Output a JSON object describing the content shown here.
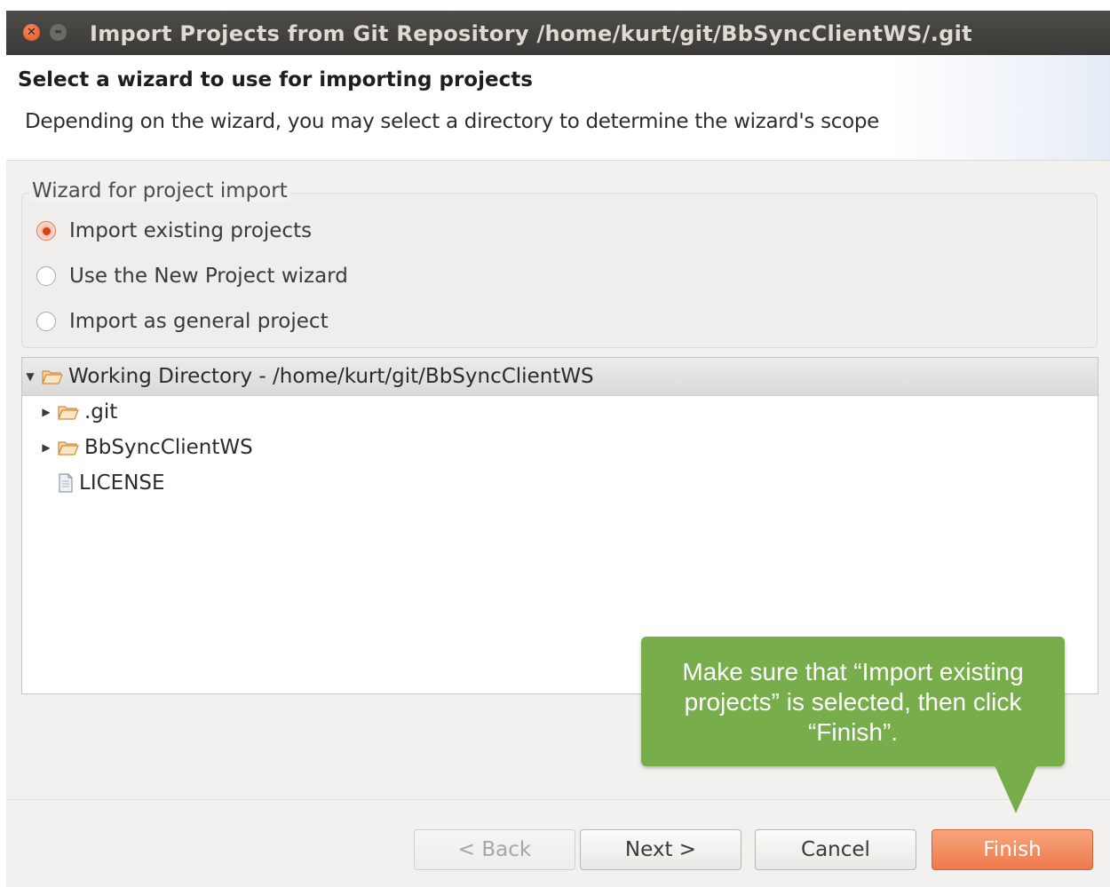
{
  "window": {
    "title": "Import Projects from Git Repository /home/kurt/git/BbSyncClientWS/.git"
  },
  "header": {
    "title": "Select a wizard to use for importing projects",
    "description": "Depending on the wizard, you may select a directory to determine the wizard's scope"
  },
  "wizard_group": {
    "legend": "Wizard for project import",
    "options": [
      {
        "label": "Import existing projects",
        "selected": true
      },
      {
        "label": "Use the New Project wizard",
        "selected": false
      },
      {
        "label": "Import as general project",
        "selected": false
      }
    ]
  },
  "tree": {
    "root": {
      "label": "Working Directory - /home/kurt/git/BbSyncClientWS",
      "expanded": true,
      "icon": "folder-icon"
    },
    "children": [
      {
        "label": ".git",
        "type": "folder",
        "icon": "folder-icon"
      },
      {
        "label": "BbSyncClientWS",
        "type": "folder",
        "icon": "folder-icon"
      },
      {
        "label": "LICENSE",
        "type": "file",
        "icon": "file-icon"
      }
    ]
  },
  "buttons": {
    "back": "< Back",
    "next": "Next >",
    "cancel": "Cancel",
    "finish": "Finish"
  },
  "callout": {
    "text": "Make sure that “Import existing projects” is selected, then click “Finish”."
  },
  "colors": {
    "titlebar": "#3b3a37",
    "accent_orange": "#ee7a4b",
    "callout_green": "#78ad4b",
    "radio_selected": "#d6401a"
  }
}
